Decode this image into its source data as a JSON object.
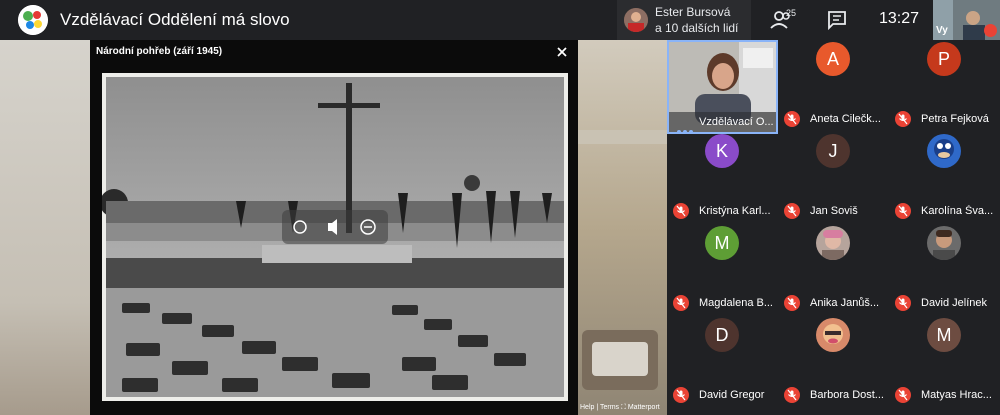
{
  "meeting": {
    "title": "Vzdělávací Oddělení má slovo"
  },
  "presenter": {
    "line1": "Ester Bursová",
    "line2": "a 10 dalších lidí"
  },
  "header": {
    "people_count": "25",
    "clock": "13:27",
    "self_label": "Vy"
  },
  "modal": {
    "title": "Národní pohřeb (září 1945)"
  },
  "footer": {
    "matterport": "Help  |  Terms  ⛶ Matterport"
  },
  "active_speaker": {
    "name": "Vzdělávací O..."
  },
  "participants": [
    {
      "name": "Aneta Cilečk...",
      "initial": "A",
      "color": "#e8592c",
      "photo": false
    },
    {
      "name": "Petra Fejková",
      "initial": "P",
      "color": "#c5391c",
      "photo": false
    },
    {
      "name": "Kristýna Karl...",
      "initial": "K",
      "color": "#8a4bc9",
      "photo": false
    },
    {
      "name": "Jan Soviš",
      "initial": "J",
      "color": "#4e342e",
      "photo": false
    },
    {
      "name": "Karolína Šva...",
      "initial": "",
      "color": "#2f69c9",
      "photo": true
    },
    {
      "name": "Magdalena B...",
      "initial": "M",
      "color": "#5e9e35",
      "photo": false
    },
    {
      "name": "Anika Janůš...",
      "initial": "",
      "color": "#a08c84",
      "photo": true
    },
    {
      "name": "David Jelínek",
      "initial": "",
      "color": "#6b6b6b",
      "photo": true
    },
    {
      "name": "David Gregor",
      "initial": "D",
      "color": "#4e342e",
      "photo": false
    },
    {
      "name": "Barbora Dost...",
      "initial": "",
      "color": "#d88a6a",
      "photo": true
    },
    {
      "name": "Matyas Hrac...",
      "initial": "M",
      "color": "#6d4c41",
      "photo": false
    }
  ]
}
